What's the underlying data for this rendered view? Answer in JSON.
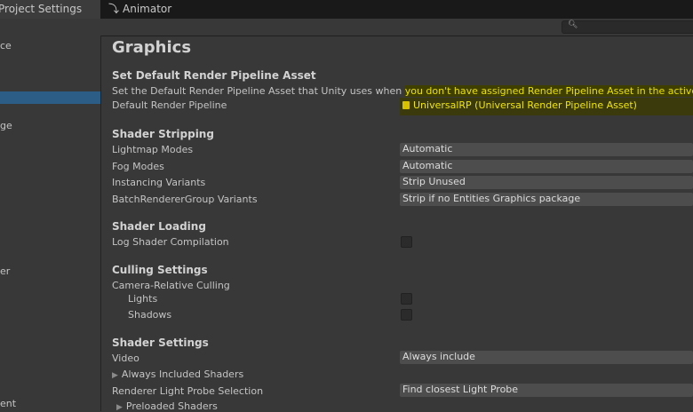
{
  "tabs": {
    "project_settings": "Project Settings",
    "animator": "Animator"
  },
  "search": {
    "icon": "search-icon"
  },
  "sidebar": {
    "items": [
      "ce",
      "",
      "ge",
      "er",
      "ent"
    ]
  },
  "main": {
    "title": "Graphics",
    "default_pipeline": {
      "header": "Set Default Render Pipeline Asset",
      "description_plain": "Set the Default Render Pipeline Asset that Unity uses when ",
      "description_highlight": "you don't have assigned Render Pipeline Asset in the active Qua",
      "label": "Default Render Pipeline",
      "value": "UniversalRP (Universal Render Pipeline Asset)"
    },
    "shader_stripping": {
      "header": "Shader Stripping",
      "lightmap_label": "Lightmap Modes",
      "lightmap_value": "Automatic",
      "fog_label": "Fog Modes",
      "fog_value": "Automatic",
      "instancing_label": "Instancing Variants",
      "instancing_value": "Strip Unused",
      "brg_label": "BatchRendererGroup Variants",
      "brg_value": "Strip if no Entities Graphics package"
    },
    "shader_loading": {
      "header": "Shader Loading",
      "log_label": "Log Shader Compilation"
    },
    "culling": {
      "header": "Culling Settings",
      "camera_relative": "Camera-Relative Culling",
      "lights": "Lights",
      "shadows": "Shadows"
    },
    "shader_settings": {
      "header": "Shader Settings",
      "video_label": "Video",
      "video_value": "Always include",
      "always_included": "Always Included Shaders",
      "probe_label": "Renderer Light Probe Selection",
      "probe_value": "Find closest Light Probe",
      "preloaded": "Preloaded Shaders"
    }
  }
}
